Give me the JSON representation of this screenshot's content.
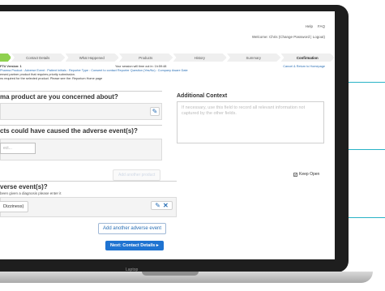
{
  "header": {
    "help_label": "Help",
    "faq_label": "FAQ",
    "welcome_text": "Welcome: Chris (Change Password | Logout)"
  },
  "steps": [
    {
      "label": ""
    },
    {
      "label": "Contact Details"
    },
    {
      "label": "What Happened"
    },
    {
      "label": "Products"
    },
    {
      "label": "History"
    },
    {
      "label": "Summary"
    },
    {
      "label": "Confirmation"
    }
  ],
  "meta": {
    "line1": "FTU  Version: 1",
    "line2": "Pharma Product : Adverse Event : Patient Initials : Reporter Type : Consent to contact Reporter Question (Yes/No) : Company Aware Date",
    "line3": "ensed partner product that requires priority submission.",
    "line4": "ns required for the selected product. Please see the: Reporium Home page",
    "session": "Your session will time out in: 1h:59:48",
    "cancel_link": "Cancel & Return to Homepage"
  },
  "section1": {
    "title": "ma product are you concerned about?"
  },
  "section2": {
    "title": "cts could have caused the adverse event(s)?",
    "input_placeholder": "ect...",
    "add_button": "Add another product"
  },
  "context": {
    "title": "Additional Context",
    "placeholder": "If necessary, use this field to record all relevant information not captured by the other fields.",
    "keep_open": "Keep Open"
  },
  "section3": {
    "title": "verse event(s)?",
    "hint": "been given a diagnosis please enter it",
    "tag": "Dizziness)",
    "add_button": "Add another adverse event"
  },
  "footer": {
    "next_button": "Next: Contact Details ▸"
  },
  "device": {
    "label": "Laptop"
  }
}
